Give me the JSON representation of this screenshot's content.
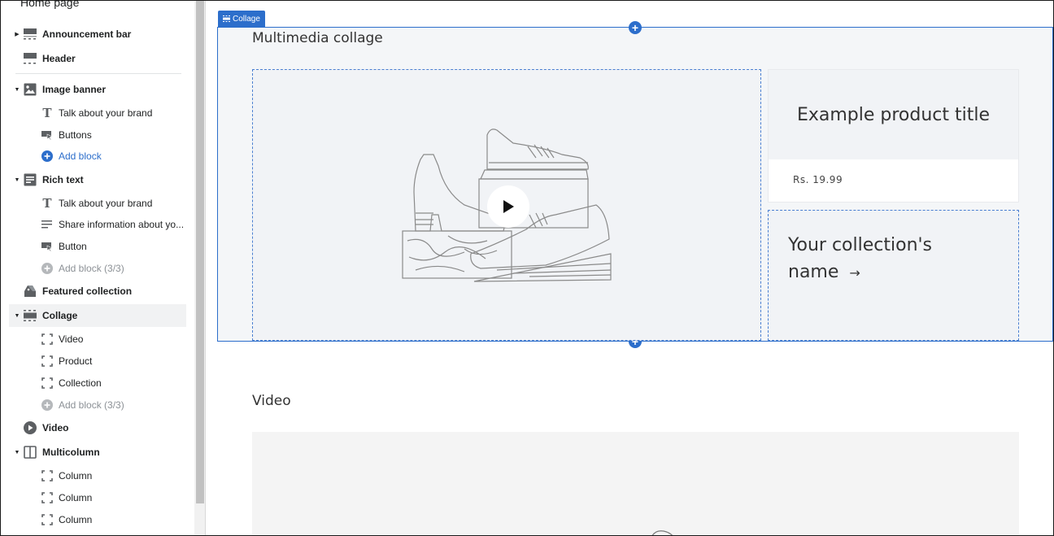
{
  "sidebar": {
    "page_title": "Home page",
    "sections": [
      {
        "label": "Announcement bar",
        "icon": "announcement-bar-icon",
        "expanded": false
      },
      {
        "label": "Header",
        "icon": "header-icon"
      },
      {
        "label": "Image banner",
        "icon": "image-icon",
        "expanded": true,
        "blocks": [
          {
            "label": "Talk about your brand",
            "icon": "text-icon"
          },
          {
            "label": "Buttons",
            "icon": "button-icon"
          },
          {
            "label": "Add block",
            "icon": "add-circle-icon",
            "type": "add"
          }
        ]
      },
      {
        "label": "Rich text",
        "icon": "rich-text-icon",
        "expanded": true,
        "blocks": [
          {
            "label": "Talk about your brand",
            "icon": "text-icon"
          },
          {
            "label": "Share information about yo...",
            "icon": "paragraph-icon"
          },
          {
            "label": "Button",
            "icon": "button-icon"
          },
          {
            "label": "Add block (3/3)",
            "icon": "add-circle-icon",
            "type": "add-disabled"
          }
        ]
      },
      {
        "label": "Featured collection",
        "icon": "tag-icon"
      },
      {
        "label": "Collage",
        "icon": "collage-icon",
        "expanded": true,
        "selected": true,
        "blocks": [
          {
            "label": "Video",
            "icon": "block-icon"
          },
          {
            "label": "Product",
            "icon": "block-icon"
          },
          {
            "label": "Collection",
            "icon": "block-icon"
          },
          {
            "label": "Add block (3/3)",
            "icon": "add-circle-icon",
            "type": "add-disabled"
          }
        ]
      },
      {
        "label": "Video",
        "icon": "play-circle-icon"
      },
      {
        "label": "Multicolumn",
        "icon": "columns-icon",
        "expanded": true,
        "blocks": [
          {
            "label": "Column",
            "icon": "block-icon"
          },
          {
            "label": "Column",
            "icon": "block-icon"
          },
          {
            "label": "Column",
            "icon": "block-icon"
          }
        ]
      }
    ]
  },
  "canvas": {
    "collage_tag": "Collage",
    "collage_title": "Multimedia collage",
    "product_title": "Example product title",
    "product_price": "Rs. 19.99",
    "collection_name": "Your collection's name",
    "collection_arrow": "→",
    "video_title": "Video"
  },
  "colors": {
    "accent": "#2c6ecb",
    "selected_row": "#f1f2f3",
    "section_bg": "#f4f6f8"
  }
}
